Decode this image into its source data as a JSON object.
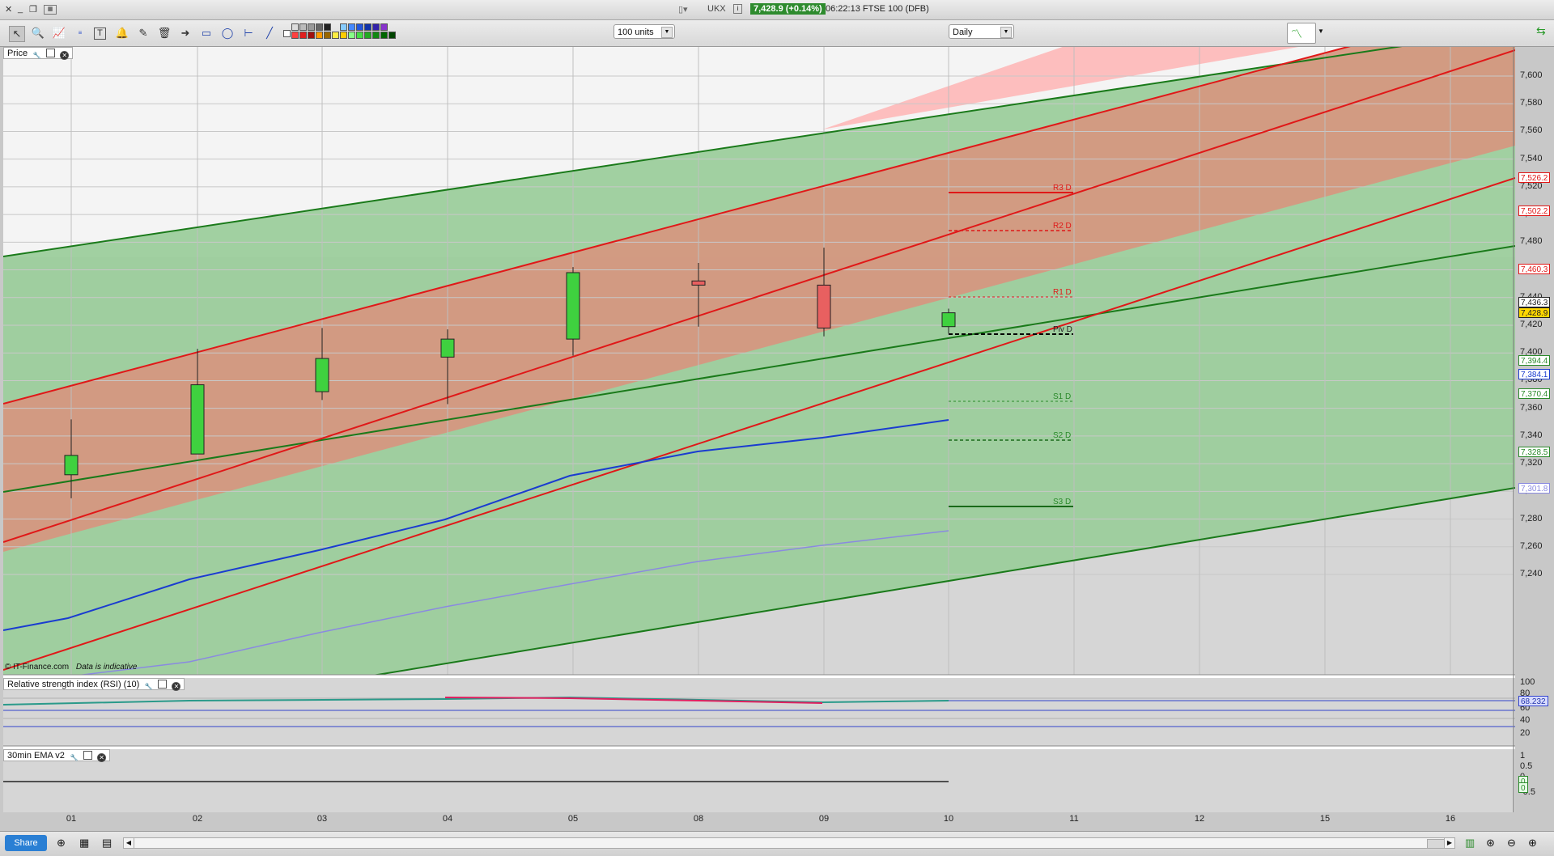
{
  "window": {
    "symbol": "UKX",
    "price_badge": "7,428.9 (+0.14%)",
    "info": "06:22:13 FTSE 100 (DFB)"
  },
  "toolbar": {
    "units_select": "100 units",
    "interval_select": "Daily"
  },
  "price_panel": {
    "title": "Price",
    "watermark": "© IT-Finance.com",
    "watermark_note": "Data is indicative",
    "y_ticks": [
      "7,600",
      "7,580",
      "7,560",
      "7,540",
      "7,520",
      "7,500",
      "7,480",
      "7,460",
      "7,440",
      "7,420",
      "7,400",
      "7,380",
      "7,360",
      "7,340",
      "7,320",
      "7,300",
      "7,280",
      "7,260",
      "7,240"
    ],
    "y_tags": [
      {
        "text": "7,526.2",
        "color": "#e01818"
      },
      {
        "text": "7,502.2",
        "color": "#e01818"
      },
      {
        "text": "7,460.3",
        "color": "#e01818"
      },
      {
        "text": "7,436.3",
        "color": "#222222"
      },
      {
        "text": "7,428.9",
        "color": "#222222"
      },
      {
        "text": "7,394.4",
        "color": "#2a8a2a"
      },
      {
        "text": "7,384.1",
        "color": "#1a3cd0"
      },
      {
        "text": "7,370.4",
        "color": "#2a8a2a"
      },
      {
        "text": "7,328.5",
        "color": "#2a8a2a"
      },
      {
        "text": "7,301.8",
        "color": "#8a8ae0"
      }
    ],
    "pivots": [
      "R3 D",
      "R2 D",
      "R1 D",
      "Piv D",
      "S1 D",
      "S2 D",
      "S3 D"
    ]
  },
  "rsi_panel": {
    "title": "Relative strength index (RSI) (10)",
    "y_ticks": [
      "100",
      "80",
      "60",
      "40",
      "20"
    ],
    "value_tag": "68.232"
  },
  "ema_panel": {
    "title": "30min EMA v2",
    "y_ticks": [
      "1",
      "0.5",
      "0",
      "-0.5"
    ],
    "tags": [
      "0",
      "0"
    ]
  },
  "x_axis": [
    "01",
    "02",
    "03",
    "04",
    "05",
    "08",
    "09",
    "10",
    "11",
    "12",
    "15",
    "16"
  ],
  "bottom": {
    "share_label": "Share"
  },
  "candles": [
    {
      "date": "01",
      "open": 7312,
      "high": 7352,
      "low": 7295,
      "close": 7326
    },
    {
      "date": "02",
      "open": 7327,
      "high": 7403,
      "low": 7327,
      "close": 7377
    },
    {
      "date": "03",
      "open": 7372,
      "high": 7418,
      "low": 7366,
      "close": 7396
    },
    {
      "date": "04",
      "open": 7397,
      "high": 7417,
      "low": 7363,
      "close": 7410
    },
    {
      "date": "05",
      "open": 7410,
      "high": 7462,
      "low": 7398,
      "close": 7458
    },
    {
      "date": "08",
      "open": 7452,
      "high": 7465,
      "low": 7419,
      "close": 7449
    },
    {
      "date": "09",
      "open": 7449,
      "high": 7476,
      "low": 7412,
      "close": 7418
    },
    {
      "date": "10",
      "open": 7419,
      "high": 7432,
      "low": 7414,
      "close": 7429
    }
  ],
  "colors": {
    "up": "#3fd13f",
    "down": "#e86060",
    "pos_tag": "#ffd700"
  }
}
